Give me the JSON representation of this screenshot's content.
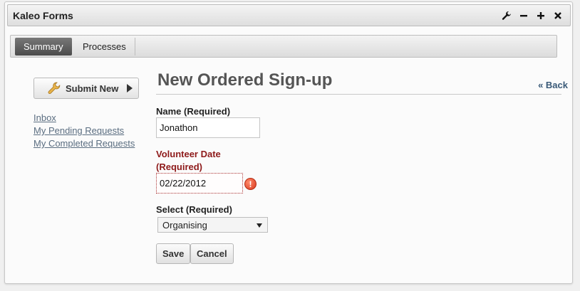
{
  "portlet": {
    "title": "Kaleo Forms",
    "icons": [
      "wrench-icon",
      "minimize-icon",
      "maximize-icon",
      "close-icon"
    ]
  },
  "tabs": [
    {
      "label": "Summary",
      "active": true
    },
    {
      "label": "Processes",
      "active": false
    }
  ],
  "sidebar": {
    "submit_label": "Submit New",
    "links": [
      "Inbox",
      "My Pending Requests",
      "My Completed Requests"
    ]
  },
  "form": {
    "heading": "New Ordered Sign-up",
    "back_label": "« Back",
    "fields": {
      "name": {
        "label": "Name (Required)",
        "value": "Jonathon"
      },
      "date": {
        "label_line1": "Volunteer Date",
        "label_line2": "(Required)",
        "value": "02/22/2012",
        "error_glyph": "!"
      },
      "select": {
        "label": "Select (Required)",
        "value": "Organising"
      }
    },
    "buttons": {
      "save": "Save",
      "cancel": "Cancel"
    }
  },
  "colors": {
    "error_text": "#8e1a1a",
    "link": "#5a6d80",
    "active_tab": "#5a5a5a"
  }
}
